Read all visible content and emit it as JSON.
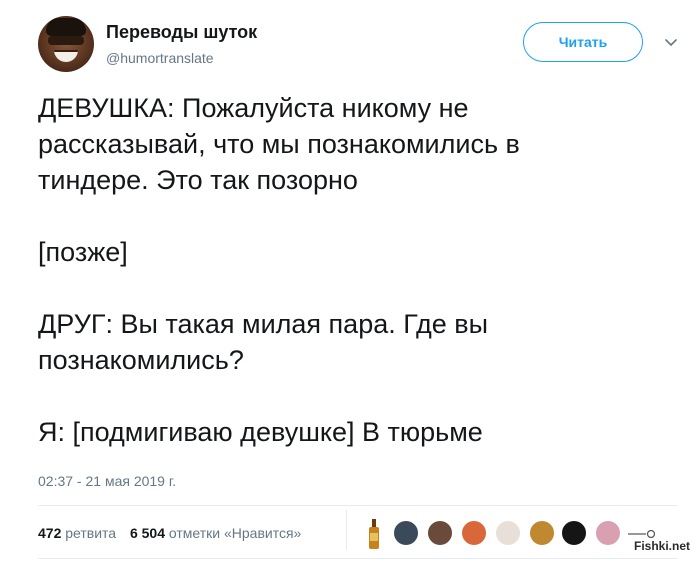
{
  "account": {
    "display_name": "Переводы шуток",
    "handle": "@humortranslate",
    "avatar_icon": "avatar-photo-icon"
  },
  "follow_button": {
    "label": "Читать"
  },
  "menu": {
    "icon": "chevron-down-icon"
  },
  "tweet": {
    "text": "ДЕВУШКА: Пожалуйста никому не\nрассказывай, что мы познакомились в\nтиндере. Это так позорно\n\n[позже]\n\nДРУГ: Вы такая милая пара. Где вы\nпознакомились?\n\nЯ: [подмигиваю девушке] В тюрьме",
    "timestamp": "02:37 - 21 мая 2019 г."
  },
  "stats": {
    "retweets_count": "472",
    "retweets_label": "ретвита",
    "likes_count": "6 504",
    "likes_label": "отметки «Нравится»"
  },
  "likers": [
    "#3a4a5a",
    "#6a4a3a",
    "#d8683a",
    "#e8e0d8",
    "#c08830",
    "#151515",
    "#d8a0b0"
  ],
  "watermark": {
    "text": "Fishki.net"
  },
  "colors": {
    "accent": "#1da1f2",
    "muted": "#657786",
    "text": "#14171a"
  }
}
